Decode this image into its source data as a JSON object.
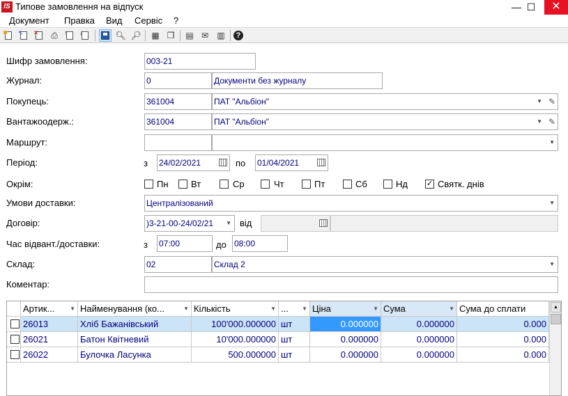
{
  "window": {
    "logo": "IS",
    "title": "Типове замовлення на відпуск",
    "min": "—",
    "max": "☐",
    "close": "✕"
  },
  "menu": [
    "Документ",
    "Правка",
    "Вид",
    "Сервіс",
    "?"
  ],
  "form": {
    "order_code": {
      "label": "Шифр замовлення:",
      "value": "003-21"
    },
    "journal": {
      "label": "Журнал:",
      "code": "0",
      "name": "Документи без журналу"
    },
    "buyer": {
      "label": "Покупець:",
      "code": "361004",
      "name": "ПАТ \"Альбіон\""
    },
    "consignee": {
      "label": "Вантажоодерж.:",
      "code": "361004",
      "name": "ПАТ \"Альбіон\""
    },
    "route": {
      "label": "Маршрут:",
      "code": "",
      "name": ""
    },
    "period": {
      "label": "Період:",
      "from_label": "з",
      "from": "24/02/2021",
      "to_label": "по",
      "to": "01/04/2021"
    },
    "except": {
      "label": "Окрім:",
      "days": [
        {
          "label": "Пн",
          "checked": false
        },
        {
          "label": "Вт",
          "checked": false
        },
        {
          "label": "Ср",
          "checked": false
        },
        {
          "label": "Чт",
          "checked": false
        },
        {
          "label": "Пт",
          "checked": false
        },
        {
          "label": "Сб",
          "checked": false
        },
        {
          "label": "Нд",
          "checked": false
        },
        {
          "label": "Святк. днів",
          "checked": true
        }
      ]
    },
    "delivery_terms": {
      "label": "Умови доставки:",
      "value": "Централізований"
    },
    "contract": {
      "label": "Договір:",
      "value": ")3-21-00-24/02/21",
      "from_label": "від",
      "date": ""
    },
    "ship_time": {
      "label": "Час відвант./доставки:",
      "from_label": "з",
      "from": "07:00",
      "to_label": "до",
      "to": "08:00"
    },
    "warehouse": {
      "label": "Склад:",
      "code": "02",
      "name": "Склад 2"
    },
    "comment": {
      "label": "Коментар:",
      "value": ""
    }
  },
  "grid": {
    "columns": [
      "Артик...",
      "Найменування (ко...",
      "Кількість",
      "...",
      "Ціна",
      "Сума",
      "Сума до сплати"
    ],
    "rows": [
      {
        "article": "26013",
        "name": "Хліб Бажанівський",
        "qty": "100'000.000000",
        "unit": "шт",
        "price": "0.000000",
        "sum": "0.000000",
        "to_pay": "0.000"
      },
      {
        "article": "26021",
        "name": "Батон Квітневий",
        "qty": "10'000.000000",
        "unit": "шт",
        "price": "0.000000",
        "sum": "0.000000",
        "to_pay": "0.000"
      },
      {
        "article": "26022",
        "name": "Булочка Ласунка",
        "qty": "500.000000",
        "unit": "шт",
        "price": "0.000000",
        "sum": "0.000000",
        "to_pay": "0.000"
      }
    ]
  },
  "icons": {
    "dropdown": "▼",
    "pencil": "✎",
    "scroll_up": "▲",
    "check": "✓"
  }
}
